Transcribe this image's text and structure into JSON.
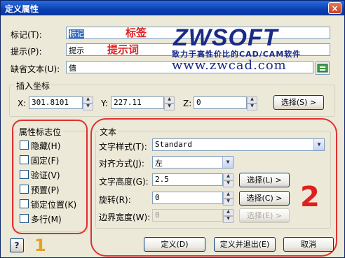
{
  "window": {
    "title": "定义属性",
    "close_glyph": "×"
  },
  "attribute": {
    "tag_label": "标记(T):",
    "tag_value": "标记",
    "prompt_label": "提示(P):",
    "prompt_value": "提示",
    "default_label": "缺省文本(U):",
    "default_value": "值"
  },
  "annotations": {
    "tag_note": "标签",
    "prompt_note": "提示词",
    "number1": "1",
    "number2": "2"
  },
  "logo": {
    "brand": "ZWSOFT",
    "slogan": "致力于高性价比的CAD/CAM软件",
    "url": "www.zwcad.com"
  },
  "insert_point": {
    "group_label": "插入坐标",
    "x_label": "X:",
    "x_value": "301.8101",
    "y_label": "Y:",
    "y_value": "227.11",
    "z_label": "Z:",
    "z_value": "0",
    "select_button": "选择(S) >"
  },
  "flags": {
    "group_label": "属性标志位",
    "items": [
      "隐藏(H)",
      "固定(F)",
      "验证(V)",
      "预置(P)",
      "锁定位置(K)",
      "多行(M)"
    ]
  },
  "text": {
    "group_label": "文本",
    "style_label": "文字样式(T):",
    "style_value": "Standard",
    "align_label": "对齐方式(J):",
    "align_value": "左",
    "height_label": "文字高度(G):",
    "height_value": "2.5",
    "height_button": "选择(L) >",
    "rotation_label": "旋转(R):",
    "rotation_value": "0",
    "rotation_button": "选择(C) >",
    "width_label": "边界宽度(W):",
    "width_value": "0",
    "width_button": "选择(E) >"
  },
  "footer": {
    "help": "?",
    "define": "定义(D)",
    "define_exit": "定义并退出(E)",
    "cancel": "取消"
  },
  "colors": {
    "accent": "#0a3fb0",
    "annotation": "#e02020"
  }
}
